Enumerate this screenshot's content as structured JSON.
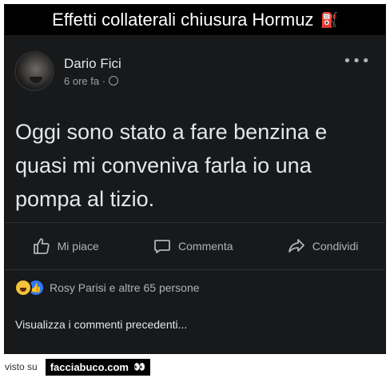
{
  "header": {
    "title": "Effetti collaterali chiusura Hormuz",
    "icon": "fuel-pump-icon"
  },
  "post": {
    "author": "Dario Fici",
    "time": "6 ore fa ·",
    "privacy_icon": "globe-icon",
    "text": "Oggi sono stato a fare benzina e quasi mi conveniva farla io una pompa al tizio."
  },
  "actions": {
    "like": "Mi piace",
    "comment": "Commenta",
    "share": "Condividi"
  },
  "reactions": {
    "summary": "Rosy Parisi e altre 65 persone"
  },
  "comments": {
    "view_previous": "Visualizza i commenti precedenti..."
  },
  "footer": {
    "seen_on": "visto su",
    "brand": "facciabuco.com"
  }
}
